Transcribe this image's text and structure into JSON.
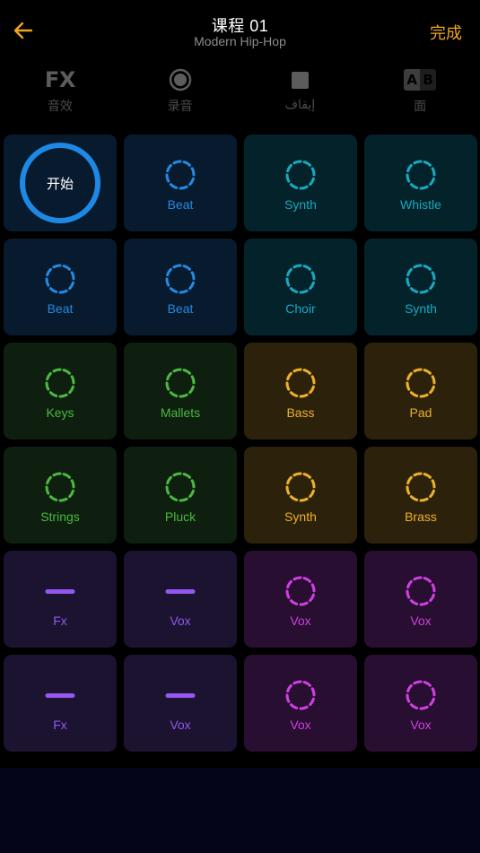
{
  "header": {
    "back_icon": "arrow-left-icon",
    "title": "课程 01",
    "subtitle": "Modern Hip-Hop",
    "done_label": "完成"
  },
  "toolbar": [
    {
      "icon": "fx-icon",
      "glyph": "FX",
      "label": "音效"
    },
    {
      "icon": "record-icon",
      "label": "录音"
    },
    {
      "icon": "stop-icon",
      "label": "إيقاف"
    },
    {
      "icon": "ab-toggle-icon",
      "glyph_a": "A",
      "glyph_b": "B",
      "label": "面"
    }
  ],
  "colors": {
    "accent": "#f0a423",
    "blue": "#1e88e5",
    "cyan": "#1ab3c9",
    "green": "#4cc043",
    "yellow": "#f0b429",
    "violet": "#9b59f5",
    "magenta": "#d83de8"
  },
  "pads": [
    {
      "label": "开始",
      "type": "start",
      "bg": "#071a2e",
      "color": "#1e88e5"
    },
    {
      "label": "Beat",
      "type": "ring",
      "bg": "#071a2e",
      "color": "#2589e0"
    },
    {
      "label": "Synth",
      "type": "ring",
      "bg": "#04222a",
      "color": "#17a9bf"
    },
    {
      "label": "Whistle",
      "type": "ring",
      "bg": "#04222a",
      "color": "#17a9bf"
    },
    {
      "label": "Beat",
      "type": "ring",
      "bg": "#071a2e",
      "color": "#2589e0"
    },
    {
      "label": "Beat",
      "type": "ring",
      "bg": "#071a2e",
      "color": "#2589e0"
    },
    {
      "label": "Choir",
      "type": "ring",
      "bg": "#04222a",
      "color": "#17a9bf"
    },
    {
      "label": "Synth",
      "type": "ring",
      "bg": "#04222a",
      "color": "#17a9bf"
    },
    {
      "label": "Keys",
      "type": "ring",
      "bg": "#0e1f10",
      "color": "#4cb840"
    },
    {
      "label": "Mallets",
      "type": "ring",
      "bg": "#0e1f10",
      "color": "#4cb840"
    },
    {
      "label": "Bass",
      "type": "ring",
      "bg": "#2c220b",
      "color": "#edb02a"
    },
    {
      "label": "Pad",
      "type": "ring",
      "bg": "#2c220b",
      "color": "#edb02a"
    },
    {
      "label": "Strings",
      "type": "ring",
      "bg": "#0e1f10",
      "color": "#4cb840"
    },
    {
      "label": "Pluck",
      "type": "ring",
      "bg": "#0e1f10",
      "color": "#4cb840"
    },
    {
      "label": "Synth",
      "type": "ring",
      "bg": "#2c220b",
      "color": "#edb02a"
    },
    {
      "label": "Brass",
      "type": "ring",
      "bg": "#2c220b",
      "color": "#edb02a"
    },
    {
      "label": "Fx",
      "type": "dash",
      "bg": "#1b1330",
      "color": "#9457f0"
    },
    {
      "label": "Vox",
      "type": "dash",
      "bg": "#1b1330",
      "color": "#9457f0"
    },
    {
      "label": "Vox",
      "type": "ring",
      "bg": "#280e30",
      "color": "#d03fe3"
    },
    {
      "label": "Vox",
      "type": "ring",
      "bg": "#280e30",
      "color": "#d03fe3"
    },
    {
      "label": "Fx",
      "type": "dash",
      "bg": "#1b1330",
      "color": "#9457f0"
    },
    {
      "label": "Vox",
      "type": "dash",
      "bg": "#1b1330",
      "color": "#9457f0"
    },
    {
      "label": "Vox",
      "type": "ring",
      "bg": "#280e30",
      "color": "#d03fe3"
    },
    {
      "label": "Vox",
      "type": "ring",
      "bg": "#280e30",
      "color": "#d03fe3"
    }
  ]
}
